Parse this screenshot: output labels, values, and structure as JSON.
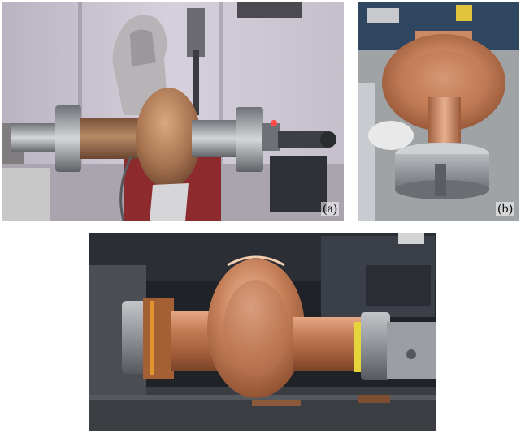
{
  "panels": [
    {
      "id": "a",
      "label": "(a)"
    },
    {
      "id": "b",
      "label": "(b)"
    },
    {
      "id": "c",
      "label": ""
    }
  ],
  "colors": {
    "copper": "#c07a55",
    "copper_light": "#e0a07e",
    "lab_wall": "#c9c3cf",
    "machine_dark": "#2a2d33",
    "steel": "#9ea3a8"
  }
}
